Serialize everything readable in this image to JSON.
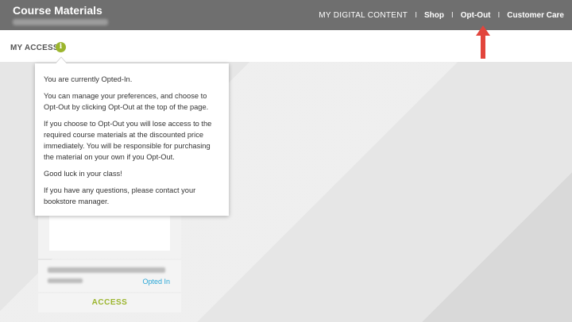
{
  "header": {
    "title": "Course Materials",
    "nav": {
      "my_digital": "MY DIGITAL",
      "content": " CONTENT",
      "separator": "I",
      "shop": "Shop",
      "opt_out": "Opt-Out",
      "customer_care": "Customer Care"
    }
  },
  "access_bar": {
    "label": "MY ACCESS:",
    "info_glyph": "i"
  },
  "tooltip": {
    "paragraphs": [
      "You are currently Opted-In.",
      "You can manage your preferences, and choose to Opt-Out by clicking Opt-Out at the top of the page.",
      "If you choose to Opt-Out you will lose access to the required course materials at the discounted price immediately. You will be responsible for purchasing the material on your own if you Opt-Out.",
      "Good luck in your class!",
      "If you have any questions, please contact your bookstore manager."
    ]
  },
  "course_card": {
    "status": "Opted In",
    "access_label": "ACCESS"
  },
  "colors": {
    "topbar": "#6f6f6f",
    "accent_green": "#9bb52d",
    "status_blue": "#27a6d6",
    "arrow_red": "#e2453c"
  }
}
